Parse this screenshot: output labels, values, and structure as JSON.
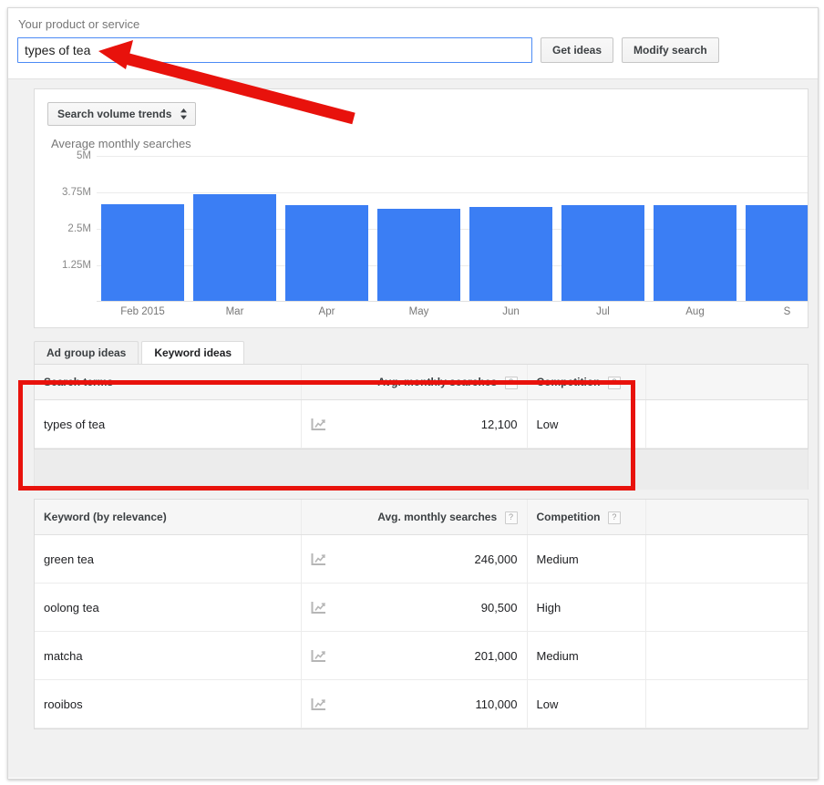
{
  "search": {
    "label": "Your product or service",
    "value": "types of tea",
    "placeholder": "",
    "get_ideas_label": "Get ideas",
    "modify_search_label": "Modify search"
  },
  "chart_panel": {
    "selector_label": "Search volume trends",
    "selector_icon": "up-down-chevron-icon",
    "title": "Average monthly searches"
  },
  "chart_data": {
    "type": "bar",
    "title": "Average monthly searches",
    "xlabel": "",
    "ylabel": "",
    "grid": true,
    "legend": "none",
    "ylim": [
      0,
      5000000
    ],
    "ytick_labels": [
      "5M",
      "3.75M",
      "2.5M",
      "1.25M"
    ],
    "ytick_values": [
      5000000,
      3750000,
      2500000,
      1250000
    ],
    "categories": [
      "Feb 2015",
      "Mar",
      "Apr",
      "May",
      "Jun",
      "Jul",
      "Aug",
      "S"
    ],
    "values": [
      3350000,
      3700000,
      3300000,
      3200000,
      3250000,
      3300000,
      3300000,
      3300000
    ]
  },
  "tabs": [
    {
      "label": "Ad group ideas",
      "active": false
    },
    {
      "label": "Keyword ideas",
      "active": true
    }
  ],
  "search_terms_table": {
    "headers": {
      "term": "Search terms",
      "volume": "Avg. monthly searches",
      "competition": "Competition",
      "extra": ""
    },
    "help_glyph": "?",
    "rows": [
      {
        "term": "types of tea",
        "sparkline_icon": "trend-chart-icon",
        "volume": "12,100",
        "competition": "Low",
        "extra": ""
      }
    ]
  },
  "keyword_ideas_table": {
    "headers": {
      "term": "Keyword (by relevance)",
      "volume": "Avg. monthly searches",
      "competition": "Competition",
      "extra": ""
    },
    "help_glyph": "?",
    "rows": [
      {
        "term": "green tea",
        "sparkline_icon": "trend-chart-icon",
        "volume": "246,000",
        "competition": "Medium",
        "extra": ""
      },
      {
        "term": "oolong tea",
        "sparkline_icon": "trend-chart-icon",
        "volume": "90,500",
        "competition": "High",
        "extra": ""
      },
      {
        "term": "matcha",
        "sparkline_icon": "trend-chart-icon",
        "volume": "201,000",
        "competition": "Medium",
        "extra": ""
      },
      {
        "term": "rooibos",
        "sparkline_icon": "trend-chart-icon",
        "volume": "110,000",
        "competition": "Low",
        "extra": ""
      }
    ]
  },
  "annotations": {
    "arrow_color": "#e8120c",
    "highlight_box_color": "#e8120c",
    "arrow_icon": "red-arrow-pointing-to-search-input",
    "highlight_name": "red-highlight-box-around-search-terms-table"
  },
  "colors": {
    "bar": "#3b7ef4",
    "input_focus_border": "#4c8bf5",
    "page_background": "#f1f1f1"
  }
}
